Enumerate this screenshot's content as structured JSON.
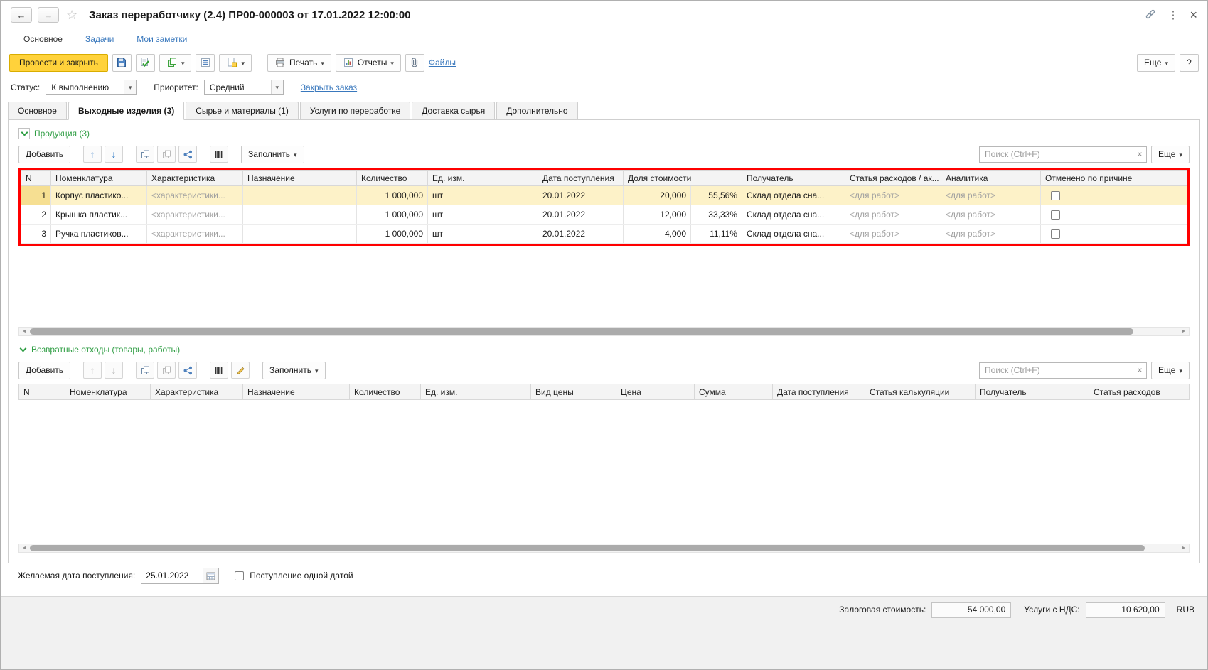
{
  "titlebar": {
    "title": "Заказ переработчику (2.4) ПР00-000003 от 17.01.2022 12:00:00"
  },
  "nav": {
    "main": "Основное",
    "tasks": "Задачи",
    "notes": "Мои заметки"
  },
  "toolbar": {
    "post_and_close": "Провести и закрыть",
    "print": "Печать",
    "reports": "Отчеты",
    "files": "Файлы",
    "more": "Еще",
    "help": "?"
  },
  "status_row": {
    "status_label": "Статус:",
    "status_value": "К выполнению",
    "priority_label": "Приоритет:",
    "priority_value": "Средний",
    "close_order": "Закрыть заказ"
  },
  "tabs": {
    "main": "Основное",
    "output": "Выходные изделия (3)",
    "materials": "Сырье и материалы (1)",
    "services": "Услуги по переработке",
    "delivery": "Доставка сырья",
    "additional": "Дополнительно"
  },
  "products": {
    "section_title": "Продукция (3)",
    "add_button": "Добавить",
    "fill_button": "Заполнить",
    "more_button": "Еще",
    "search_placeholder": "Поиск (Ctrl+F)",
    "headers": {
      "n": "N",
      "nomenclature": "Номенклатура",
      "characteristic": "Характеристика",
      "purpose": "Назначение",
      "quantity": "Количество",
      "unit": "Ед. изм.",
      "receipt_date": "Дата поступления",
      "cost_share": "Доля стоимости",
      "receiver": "Получатель",
      "expense_item": "Статья расходов / ак...",
      "analytics": "Аналитика",
      "cancelled": "Отменено по причине"
    },
    "rows": [
      {
        "n": "1",
        "nomenclature": "Корпус пластико...",
        "characteristic": "<характеристики...",
        "purpose": "",
        "quantity": "1 000,000",
        "unit": "шт",
        "receipt_date": "20.01.2022",
        "cost_share": "20,000",
        "cost_share_pct": "55,56%",
        "receiver": "Склад отдела сна...",
        "expense_item": "<для работ>",
        "analytics": "<для работ>"
      },
      {
        "n": "2",
        "nomenclature": "Крышка пластик...",
        "characteristic": "<характеристики...",
        "purpose": "",
        "quantity": "1 000,000",
        "unit": "шт",
        "receipt_date": "20.01.2022",
        "cost_share": "12,000",
        "cost_share_pct": "33,33%",
        "receiver": "Склад отдела сна...",
        "expense_item": "<для работ>",
        "analytics": "<для работ>"
      },
      {
        "n": "3",
        "nomenclature": "Ручка пластиков...",
        "characteristic": "<характеристики...",
        "purpose": "",
        "quantity": "1 000,000",
        "unit": "шт",
        "receipt_date": "20.01.2022",
        "cost_share": "4,000",
        "cost_share_pct": "11,11%",
        "receiver": "Склад отдела сна...",
        "expense_item": "<для работ>",
        "analytics": "<для работ>"
      }
    ]
  },
  "waste": {
    "section_title": "Возвратные отходы (товары, работы)",
    "add_button": "Добавить",
    "fill_button": "Заполнить",
    "more_button": "Еще",
    "search_placeholder": "Поиск (Ctrl+F)",
    "headers": {
      "n": "N",
      "nomenclature": "Номенклатура",
      "characteristic": "Характеристика",
      "purpose": "Назначение",
      "quantity": "Количество",
      "unit": "Ед. изм.",
      "price_type": "Вид цены",
      "price": "Цена",
      "sum": "Сумма",
      "receipt_date": "Дата поступления",
      "calc_item": "Статья калькуляции",
      "receiver": "Получатель",
      "expense_item": "Статья расходов"
    }
  },
  "bottom": {
    "desired_date_label": "Желаемая дата поступления:",
    "desired_date_value": "25.01.2022",
    "single_date_label": "Поступление одной датой"
  },
  "footer": {
    "pledge_label": "Залоговая стоимость:",
    "pledge_value": "54 000,00",
    "vat_label": "Услуги с НДС:",
    "vat_value": "10 620,00",
    "currency": "RUB"
  },
  "colors": {
    "highlight_frame": "#ff0000",
    "selected_row": "#fdf2c8",
    "primary_button": "#ffd23b",
    "link": "#3978bd",
    "section_green": "#2f9e44"
  }
}
